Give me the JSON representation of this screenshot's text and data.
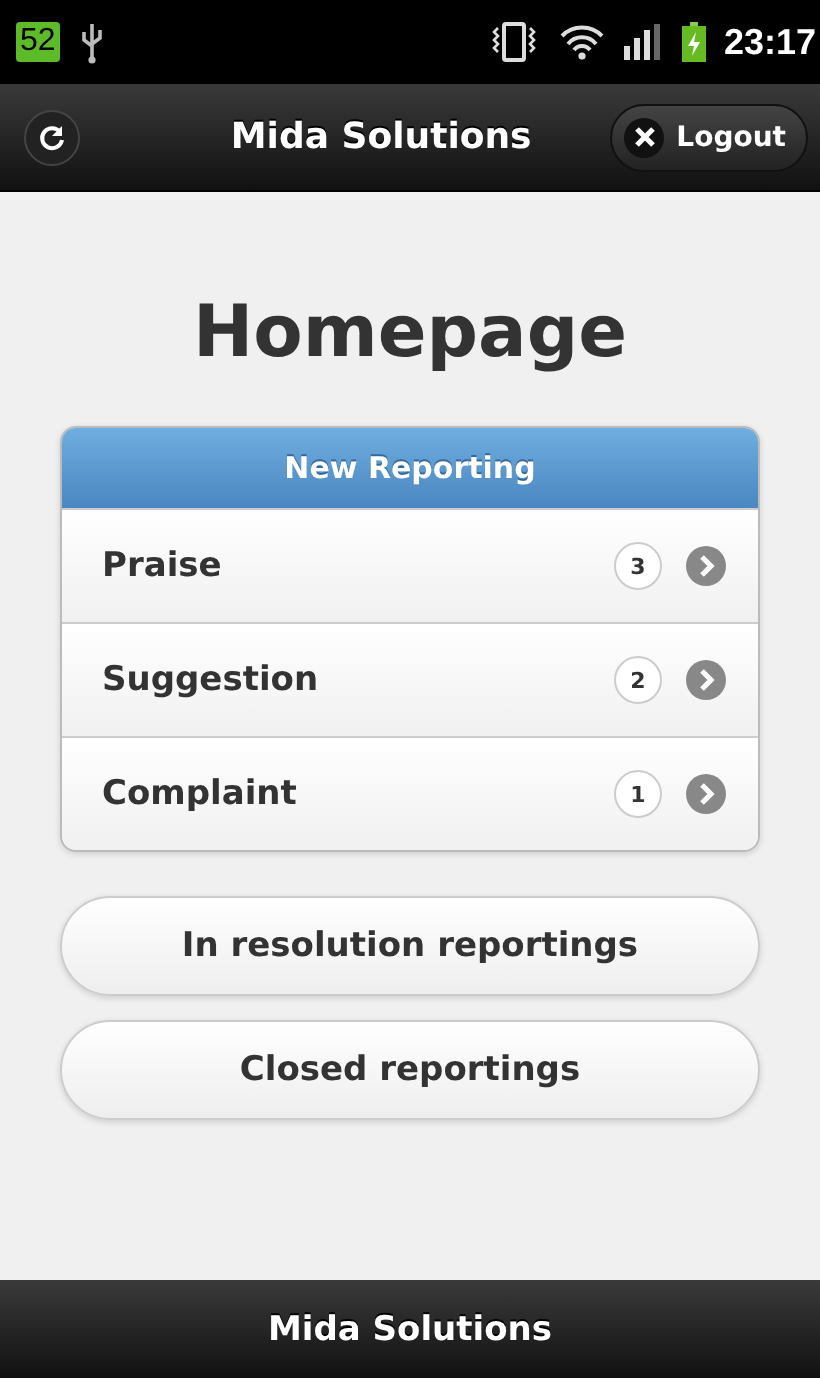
{
  "status_bar": {
    "battery_percent": "52",
    "time": "23:17"
  },
  "header": {
    "title": "Mida Solutions",
    "logout": "Logout"
  },
  "page_title": "Homepage",
  "new_reporting": {
    "title": "New Reporting",
    "items": [
      {
        "label": "Praise",
        "count": "3"
      },
      {
        "label": "Suggestion",
        "count": "2"
      },
      {
        "label": "Complaint",
        "count": "1"
      }
    ]
  },
  "buttons": [
    "In resolution reportings",
    "Closed reportings"
  ],
  "footer": {
    "title": "Mida Solutions"
  }
}
